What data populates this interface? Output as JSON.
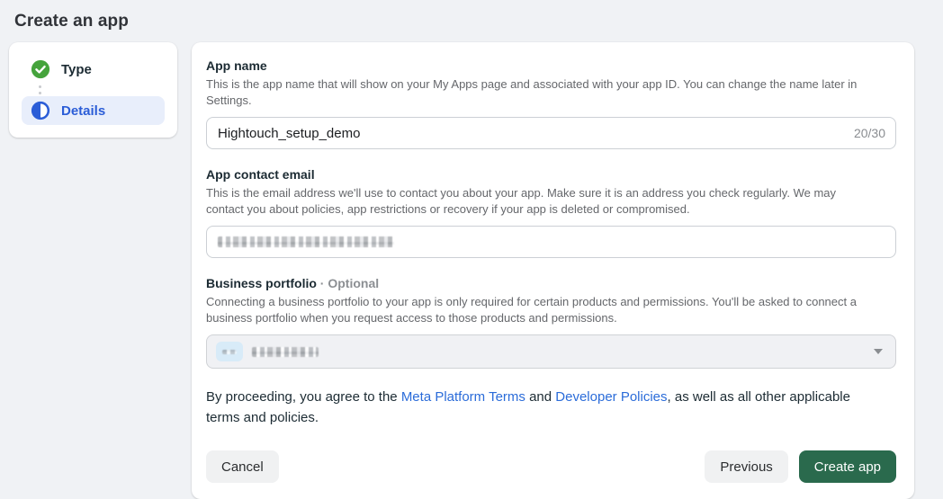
{
  "page": {
    "title": "Create an app"
  },
  "stepper": {
    "steps": [
      {
        "label": "Type",
        "state": "complete",
        "icon": "check-circle-icon"
      },
      {
        "label": "Details",
        "state": "current",
        "icon": "half-circle-icon"
      }
    ]
  },
  "form": {
    "app_name": {
      "label": "App name",
      "description": "This is the app name that will show on your My Apps page and associated with your app ID. You can change the name later in Settings.",
      "value": "Hightouch_setup_demo",
      "counter": "20/30"
    },
    "contact_email": {
      "label": "App contact email",
      "description": "This is the email address we'll use to contact you about your app. Make sure it is an address you check regularly. We may contact you about policies, app restrictions or recovery if your app is deleted or compromised.",
      "value_redacted": true
    },
    "business_portfolio": {
      "label": "Business portfolio",
      "optional_label": "· Optional",
      "description": "Connecting a business portfolio to your app is only required for certain products and permissions. You'll be asked to connect a business portfolio when you request access to those products and permissions.",
      "selected_value_redacted": true
    }
  },
  "terms": {
    "prefix": "By proceeding, you agree to the ",
    "link1": "Meta Platform Terms",
    "middle": " and ",
    "link2": "Developer Policies",
    "suffix": ", as well as all other applicable terms and policies."
  },
  "footer": {
    "cancel": "Cancel",
    "previous": "Previous",
    "create": "Create app"
  },
  "colors": {
    "page_background": "#f0f2f5",
    "success_green": "#45a33c",
    "accent_blue": "#2b5dd7",
    "link_blue": "#2b6cd9",
    "primary_button_green": "#2a6a4d",
    "step_highlight": "#e8eefb"
  }
}
